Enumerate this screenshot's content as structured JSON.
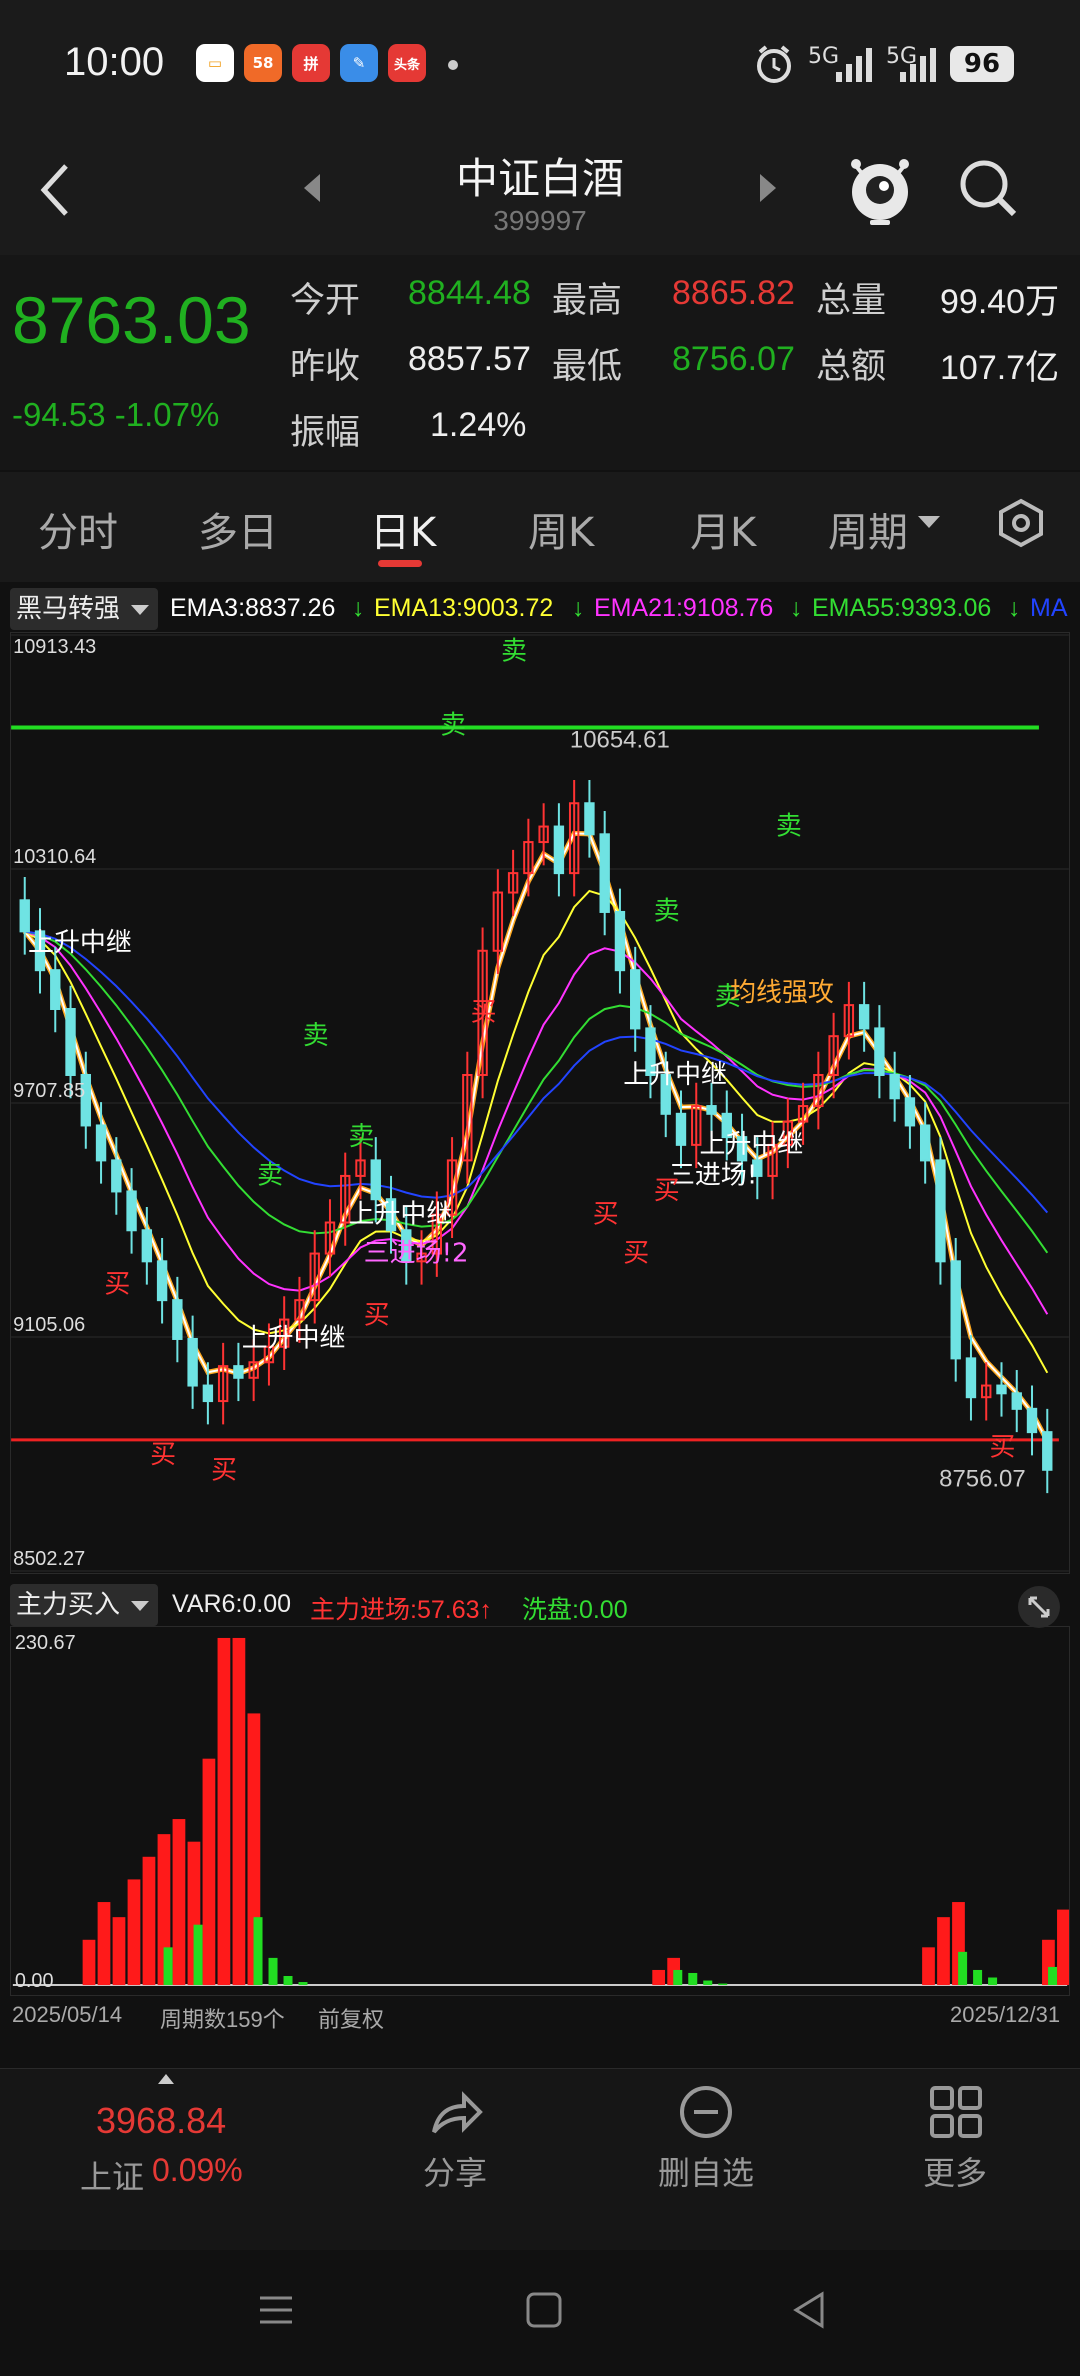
{
  "status_bar": {
    "time": "10:00",
    "signal": "5G",
    "battery": "96",
    "apps": [
      {
        "label": "▭",
        "color": "#f5f5f5"
      },
      {
        "label": "58",
        "color": "#f06a28"
      },
      {
        "label": "拼",
        "color": "#e53935"
      },
      {
        "label": "✎",
        "color": "#3a8de8"
      },
      {
        "label": "头条",
        "color": "#e53935"
      }
    ]
  },
  "header": {
    "title": "中证白酒",
    "code": "399997"
  },
  "quote": {
    "price": "8763.03",
    "change": "-94.53 -1.07%",
    "open_label": "今开",
    "open": "8844.48",
    "high_label": "最高",
    "high": "8865.82",
    "volume_label": "总量",
    "volume": "99.40万",
    "prev_close_label": "昨收",
    "prev_close": "8857.57",
    "low_label": "最低",
    "low": "8756.07",
    "amount_label": "总额",
    "amount": "107.7亿",
    "amplitude_label": "振幅",
    "amplitude": "1.24%"
  },
  "tabs": [
    {
      "label": "分时"
    },
    {
      "label": "多日"
    },
    {
      "label": "日K"
    },
    {
      "label": "周K"
    },
    {
      "label": "月K"
    },
    {
      "label": "周期"
    }
  ],
  "indicator": {
    "name": "黑马转强",
    "ema3": "EMA3:8837.26",
    "ema13": "EMA13:9003.72",
    "ema21": "EMA21:9108.76",
    "ema55": "EMA55:9393.06",
    "ma": "MA",
    "colors": {
      "ema3": "#ffffff",
      "ema13": "#ffff33",
      "ema21": "#ff33ff",
      "ema55": "#33dd33",
      "ma": "#2244ff"
    }
  },
  "chart_data": {
    "type": "candlestick",
    "y_labels": [
      "10913.43",
      "10310.64",
      "9707.85",
      "9105.06",
      "8502.27"
    ],
    "ylim": [
      8502.27,
      10913.43
    ],
    "peak_label": "10654.61",
    "last_label": "8756.07",
    "resistance": 10654.61,
    "support": 8840,
    "closes": [
      10150,
      10050,
      9950,
      9780,
      9650,
      9560,
      9480,
      9380,
      9300,
      9200,
      9100,
      8980,
      8940,
      9030,
      9000,
      9040,
      9080,
      9150,
      9200,
      9320,
      9400,
      9520,
      9560,
      9460,
      9380,
      9300,
      9320,
      9420,
      9560,
      9780,
      10100,
      10250,
      10300,
      10380,
      10420,
      10300,
      10480,
      10400,
      10200,
      10050,
      9900,
      9780,
      9680,
      9600,
      9700,
      9680,
      9620,
      9560,
      9520,
      9600,
      9660,
      9700,
      9780,
      9880,
      9960,
      9900,
      9780,
      9720,
      9650,
      9560,
      9300,
      9050,
      8950,
      8980,
      8960,
      8920,
      8860,
      8763
    ],
    "annotations": [
      {
        "text": "卖",
        "color": "#33dd33",
        "v": 10850,
        "i": 32
      },
      {
        "text": "卖",
        "color": "#33dd33",
        "v": 10660,
        "i": 28
      },
      {
        "text": "卖",
        "color": "#33dd33",
        "v": 10400,
        "i": 50
      },
      {
        "text": "卖",
        "color": "#33dd33",
        "v": 10180,
        "i": 42
      },
      {
        "text": "卖",
        "color": "#33dd33",
        "v": 9860,
        "i": 19
      },
      {
        "text": "卖",
        "color": "#33dd33",
        "v": 9600,
        "i": 22
      },
      {
        "text": "卖",
        "color": "#33dd33",
        "v": 9500,
        "i": 16
      },
      {
        "text": "卖",
        "color": "#33dd33",
        "v": 9960,
        "i": 46
      },
      {
        "text": "上升中继",
        "color": "#ffffff",
        "v": 10100,
        "i": 1
      },
      {
        "text": "上升中继",
        "color": "#ffffff",
        "v": 9080,
        "i": 15
      },
      {
        "text": "上升中继",
        "color": "#ffffff",
        "v": 9400,
        "i": 22
      },
      {
        "text": "上升中继",
        "color": "#ffffff",
        "v": 9760,
        "i": 40
      },
      {
        "text": "上升中继",
        "color": "#ffffff",
        "v": 9580,
        "i": 45
      },
      {
        "text": "三进场!",
        "color": "#ffffff",
        "v": 9500,
        "i": 43
      },
      {
        "text": "三进场!2",
        "color": "#ff66ff",
        "v": 9300,
        "i": 23
      },
      {
        "text": "均线强攻",
        "color": "#ffaa33",
        "v": 9970,
        "i": 47
      },
      {
        "text": "买",
        "color": "#ff3333",
        "v": 9220,
        "i": 6
      },
      {
        "text": "买",
        "color": "#ff3333",
        "v": 8780,
        "i": 9
      },
      {
        "text": "买",
        "color": "#ff3333",
        "v": 8740,
        "i": 13
      },
      {
        "text": "买",
        "color": "#ff3333",
        "v": 9140,
        "i": 23
      },
      {
        "text": "买",
        "color": "#ff3333",
        "v": 9920,
        "i": 30
      },
      {
        "text": "买",
        "color": "#ff3333",
        "v": 9400,
        "i": 38
      },
      {
        "text": "买",
        "color": "#ff3333",
        "v": 9300,
        "i": 40
      },
      {
        "text": "买",
        "color": "#ff3333",
        "v": 9460,
        "i": 42
      },
      {
        "text": "买",
        "color": "#ff3333",
        "v": 8800,
        "i": 64
      }
    ]
  },
  "sub_indicator": {
    "name": "主力买入",
    "var6": "VAR6:0.00",
    "main_in": "主力进场:57.63↑",
    "wash": "洗盘:0.00",
    "y_max": "230.67",
    "y_min": "0.00",
    "bars_red": [
      0,
      0,
      30,
      55,
      45,
      70,
      85,
      100,
      110,
      95,
      150,
      230,
      230,
      180,
      0,
      0,
      0,
      0,
      0,
      0,
      0,
      0,
      0,
      0,
      0,
      0,
      0,
      0,
      0,
      0,
      0,
      0,
      0,
      0,
      0,
      0,
      0,
      0,
      0,
      0,
      10,
      18,
      0,
      0,
      0,
      0,
      0,
      0,
      0,
      0,
      0,
      0,
      0,
      0,
      0,
      0,
      0,
      0,
      25,
      45,
      55,
      0,
      0,
      0,
      0,
      0,
      30,
      50,
      60
    ],
    "bars_green": [
      0,
      0,
      0,
      0,
      0,
      0,
      0,
      25,
      0,
      40,
      0,
      0,
      0,
      45,
      18,
      6,
      2,
      0,
      0,
      0,
      0,
      0,
      0,
      0,
      0,
      0,
      0,
      0,
      0,
      0,
      0,
      0,
      0,
      0,
      0,
      0,
      0,
      0,
      0,
      0,
      0,
      10,
      8,
      3,
      1,
      0,
      0,
      0,
      0,
      0,
      0,
      0,
      0,
      0,
      0,
      0,
      0,
      0,
      0,
      0,
      22,
      10,
      5,
      0,
      0,
      0,
      12,
      0,
      0
    ]
  },
  "footer": {
    "start_date": "2025/05/14",
    "periods": "周期数159个",
    "adjust": "前复权",
    "end_date": "2025/12/31"
  },
  "bottom": {
    "index_value": "3968.84",
    "index_name": "上证",
    "index_change": "0.09%",
    "share": "分享",
    "remove": "删自选",
    "more": "更多"
  }
}
